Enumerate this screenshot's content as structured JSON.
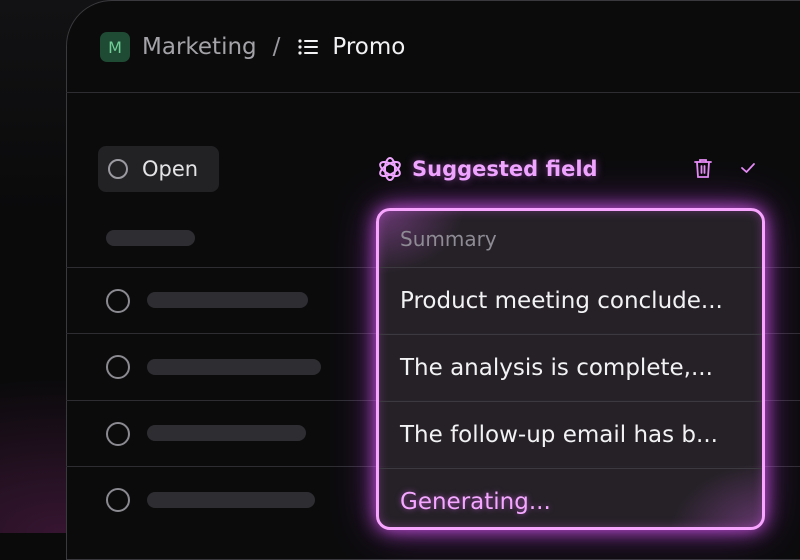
{
  "breadcrumb": {
    "workspace_initial": "M",
    "workspace_name": "Marketing",
    "separator": "/",
    "page_name": "Promo"
  },
  "filter": {
    "open_label": "Open"
  },
  "suggestion": {
    "label": "Suggested field",
    "column_header": "Summary",
    "values": [
      "Product meeting conclude...",
      "The analysis is complete,...",
      "The follow-up email has b...",
      "Generating..."
    ]
  },
  "colors": {
    "accent_glow": "#e85dff",
    "workspace_badge": "#1f4a34",
    "background": "#0a0a0b"
  },
  "icons": [
    "list-icon",
    "ai-sparkle-icon",
    "trash-icon",
    "check-icon",
    "status-circle-icon"
  ]
}
